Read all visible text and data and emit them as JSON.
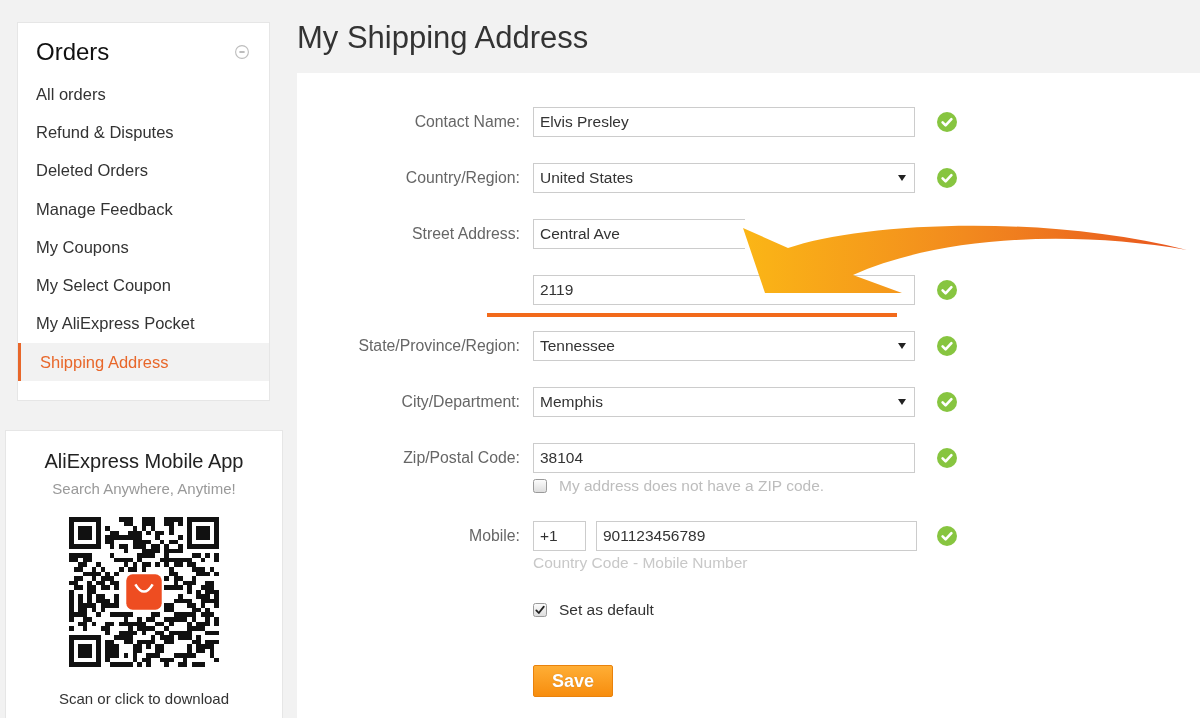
{
  "sidebar": {
    "title": "Orders",
    "expanded": true,
    "items": [
      {
        "label": "All orders",
        "selected": false
      },
      {
        "label": "Refund & Disputes",
        "selected": false
      },
      {
        "label": "Deleted Orders",
        "selected": false
      },
      {
        "label": "Manage Feedback",
        "selected": false
      },
      {
        "label": "My Coupons",
        "selected": false
      },
      {
        "label": "My Select Coupon",
        "selected": false
      },
      {
        "label": "My AliExpress Pocket",
        "selected": false
      },
      {
        "label": "Shipping Address",
        "selected": true
      }
    ]
  },
  "app_promo": {
    "title": "AliExpress Mobile App",
    "subtitle": "Search Anywhere, Anytime!",
    "caption": "Scan or click to download"
  },
  "page_title": "My Shipping Address",
  "form": {
    "fields": [
      {
        "kind": "text",
        "label": "Contact Name:",
        "value": "Elvis Presley",
        "valid": true
      },
      {
        "kind": "select",
        "label": "Country/Region:",
        "value": "United States",
        "valid": true
      },
      {
        "kind": "text",
        "label": "Street Address:",
        "value": "Central Ave"
      },
      {
        "kind": "text",
        "value": "2119",
        "valid": true
      },
      {
        "kind": "select",
        "label": "State/Province/Region:",
        "value": "Tennessee",
        "valid": true
      },
      {
        "kind": "select",
        "label": "City/Department:",
        "value": "Memphis",
        "valid": true
      },
      {
        "kind": "text",
        "label": "Zip/Postal Code:",
        "value": "38104",
        "valid": true,
        "option": {
          "label": "My address does not have a ZIP code.",
          "checked": false
        }
      },
      {
        "kind": "phone",
        "label": "Mobile:",
        "code": "+1",
        "value": "901123456789",
        "hint": "Country Code - Mobile Number",
        "valid": true
      }
    ],
    "default_option": {
      "label": "Set as default",
      "checked": true
    },
    "save_button": "Save"
  }
}
